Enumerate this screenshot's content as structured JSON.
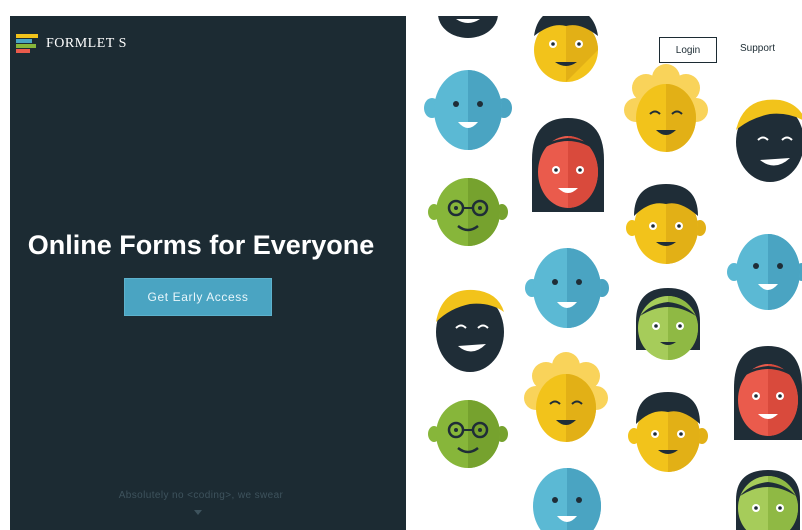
{
  "brand": {
    "name": "FORMLET S"
  },
  "hero": {
    "headline": "Online Forms for Everyone",
    "cta_label": "Get Early Access",
    "footnote": "Absolutely no <coding>, we swear"
  },
  "nav": {
    "login_label": "Login",
    "support_label": "Support"
  },
  "icons": {
    "scroll": "chevron-down-icon",
    "logo": "formlets-logo-icon"
  },
  "colors": {
    "panel": "#1c2b33",
    "accent": "#4aa4c2",
    "face_yellow": "#f2c31b",
    "face_blue": "#5bb9d4",
    "face_green": "#87b63a",
    "face_red": "#ea5b4c",
    "face_dark": "#1f2d37"
  }
}
